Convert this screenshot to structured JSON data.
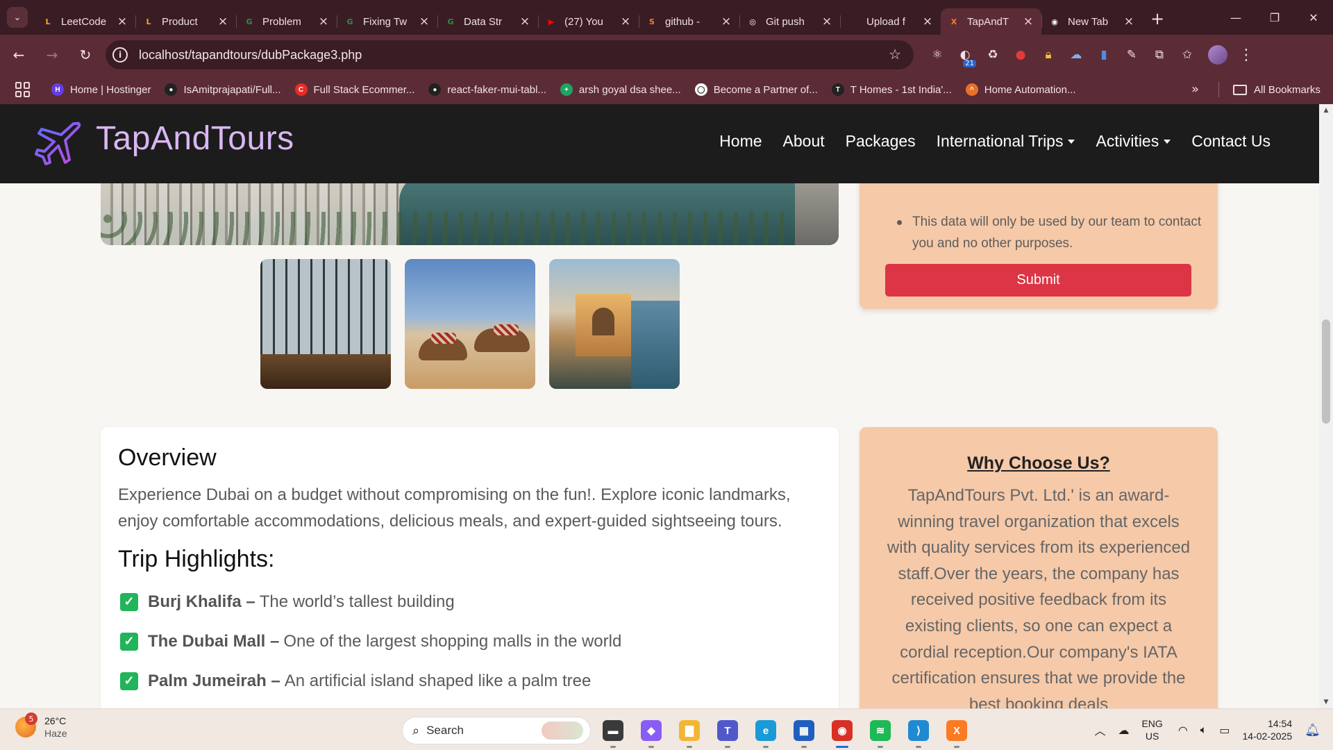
{
  "browser": {
    "tabs": [
      {
        "title": "LeetCode",
        "icon": "leetcode-icon",
        "color": "#f5a623",
        "glyph": "L"
      },
      {
        "title": "Product",
        "icon": "leetcode-icon",
        "color": "#f5a623",
        "glyph": "L"
      },
      {
        "title": "Problem",
        "icon": "gfg-icon",
        "color": "#2f8d46",
        "glyph": "G"
      },
      {
        "title": "Fixing Tw",
        "icon": "gfg-icon",
        "color": "#2f8d46",
        "glyph": "G"
      },
      {
        "title": "Data Str",
        "icon": "gfg-icon",
        "color": "#2f8d46",
        "glyph": "G"
      },
      {
        "title": "(27) You",
        "icon": "youtube-icon",
        "color": "#ff0000",
        "glyph": "▶"
      },
      {
        "title": "github -",
        "icon": "stackoverflow-icon",
        "color": "#f48024",
        "glyph": "S"
      },
      {
        "title": "Git push",
        "icon": "chatgpt-icon",
        "color": "#ffffff",
        "glyph": "◎"
      },
      {
        "title": "Upload f",
        "icon": "github-icon",
        "color": "#222222",
        "glyph": "○"
      },
      {
        "title": "TapAndT",
        "icon": "xampp-icon",
        "color": "#fb7a24",
        "glyph": "X",
        "active": true
      },
      {
        "title": "New Tab",
        "icon": "chrome-icon",
        "color": "#ffffff",
        "glyph": "◉"
      }
    ],
    "url": "localhost/tapandtours/dubPackage3.php",
    "extension_badge": "21",
    "bookmarks": [
      {
        "label": "Home | Hostinger",
        "color": "#673de6",
        "glyph": "H"
      },
      {
        "label": "IsAmitprajapati/Full...",
        "color": "#222222",
        "glyph": "●"
      },
      {
        "label": "Full Stack Ecommer...",
        "color": "#e52d27",
        "glyph": "C"
      },
      {
        "label": "react-faker-mui-tabl...",
        "color": "#222222",
        "glyph": "●"
      },
      {
        "label": "arsh goyal dsa shee...",
        "color": "#1fa463",
        "glyph": "+"
      },
      {
        "label": "Become a Partner of...",
        "color": "#ffffff",
        "glyph": "◯"
      },
      {
        "label": "T Homes - 1st India'...",
        "color": "#222222",
        "glyph": "T"
      },
      {
        "label": "Home Automation...",
        "color": "#e9702a",
        "glyph": "^"
      }
    ],
    "all_bookmarks_label": "All Bookmarks"
  },
  "site": {
    "brand": "TapAndTours",
    "menu": [
      {
        "label": "Home",
        "dropdown": false
      },
      {
        "label": "About",
        "dropdown": false
      },
      {
        "label": "Packages",
        "dropdown": false
      },
      {
        "label": "International Trips",
        "dropdown": true
      },
      {
        "label": "Activities",
        "dropdown": true
      },
      {
        "label": "Contact Us",
        "dropdown": false
      }
    ]
  },
  "form": {
    "note": "This data will only be used by our team to contact you and no other purposes.",
    "submit_label": "Submit"
  },
  "overview": {
    "title": "Overview",
    "text": "Experience Dubai on a budget without compromising on the fun!. Explore iconic landmarks, enjoy comfortable accommodations, delicious meals, and expert-guided sightseeing tours.",
    "highlights_title": "Trip Highlights:",
    "highlights": [
      {
        "name": "Burj Khalifa –",
        "desc": "The world’s tallest building"
      },
      {
        "name": "The Dubai Mall –",
        "desc": "One of the largest shopping malls in the world"
      },
      {
        "name": "Palm Jumeirah –",
        "desc": "An artificial island shaped like a palm tree"
      }
    ]
  },
  "why": {
    "title": "Why Choose Us?",
    "text": "TapAndTours Pvt. Ltd.' is an award-winning travel organization that excels with quality services from its experienced staff.Over the years, the company has received positive feedback from its existing clients, so one can expect a cordial reception.Our company's IATA certification ensures that we provide the best booking deals"
  },
  "taskbar": {
    "weather_temp": "26°C",
    "weather_desc": "Haze",
    "weather_badge": "5",
    "search_label": "Search",
    "lang_top": "ENG",
    "lang_bottom": "US",
    "time": "14:54",
    "date": "14-02-2025",
    "apps": [
      {
        "name": "file-explorer-icon",
        "color": "#3a3a3a",
        "glyph": "▬"
      },
      {
        "name": "copilot-icon",
        "color": "#8a5cf6",
        "glyph": "◆"
      },
      {
        "name": "folder-icon",
        "color": "#f2b632",
        "glyph": "▇"
      },
      {
        "name": "teams-icon",
        "color": "#5059c9",
        "glyph": "T"
      },
      {
        "name": "edge-icon",
        "color": "#1a9ad6",
        "glyph": "e"
      },
      {
        "name": "store-icon",
        "color": "#1f5fbf",
        "glyph": "▦"
      },
      {
        "name": "chrome-icon",
        "color": "#d93025",
        "glyph": "◉",
        "active": true
      },
      {
        "name": "spotify-icon",
        "color": "#1db954",
        "glyph": "≋"
      },
      {
        "name": "vscode-icon",
        "color": "#1f8ad2",
        "glyph": "⟩"
      },
      {
        "name": "xampp-icon",
        "color": "#fb7a24",
        "glyph": "X"
      }
    ]
  }
}
